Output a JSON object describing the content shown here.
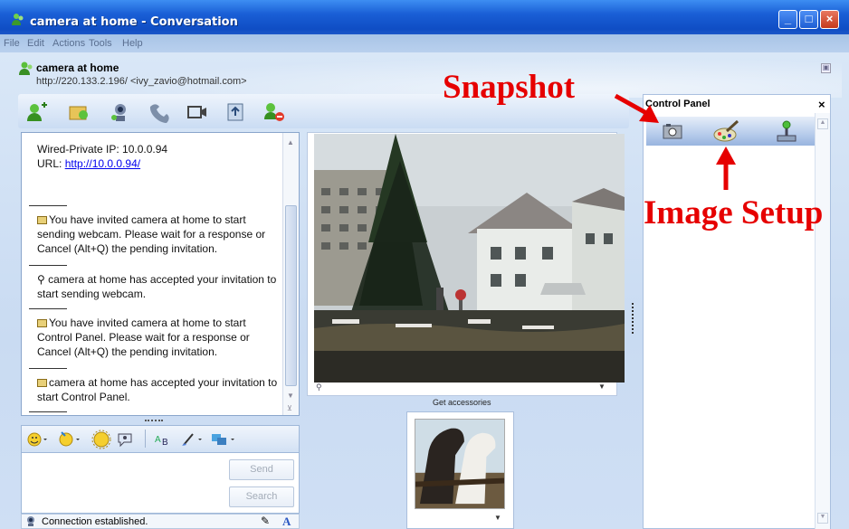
{
  "window": {
    "title": "camera at home - Conversation",
    "controls": [
      "_",
      "□",
      "×"
    ]
  },
  "menu": [
    "File",
    "Edit",
    "Actions",
    "Tools",
    "Help"
  ],
  "contact": {
    "name": "camera at home",
    "subtitle": "http://220.133.2.196/ <ivy_zavio@hotmail.com>"
  },
  "toolbar_icons": [
    "invite-contact-icon",
    "send-files-icon",
    "webcam-icon",
    "call-icon",
    "video-icon",
    "share-folder-icon",
    "block-icon"
  ],
  "chat": {
    "ip_line": "Wired-Private IP: 10.0.0.94",
    "url_label": "URL: ",
    "url": "http://10.0.0.94/",
    "messages": [
      "You have invited camera at home to start sending webcam. Please wait for a response or Cancel (Alt+Q) the pending invitation.",
      "camera at home has accepted your invitation to start sending webcam.",
      "You have invited camera at home to start Control Panel. Please wait for a response or Cancel (Alt+Q) the pending invitation.",
      "camera at home has accepted your invitation to start Control Panel."
    ]
  },
  "buttons": {
    "send": "Send",
    "search": "Search"
  },
  "status": {
    "text": "Connection established."
  },
  "accessories": {
    "title": "Get accessories"
  },
  "control_panel": {
    "title": "Control Panel",
    "close": "×"
  },
  "annotations": {
    "snapshot": "Snapshot",
    "image_setup": "Image Setup"
  },
  "colors": {
    "annotation": "#e60000",
    "title_bar": "#1a5fd6",
    "link": "#0000ee"
  }
}
